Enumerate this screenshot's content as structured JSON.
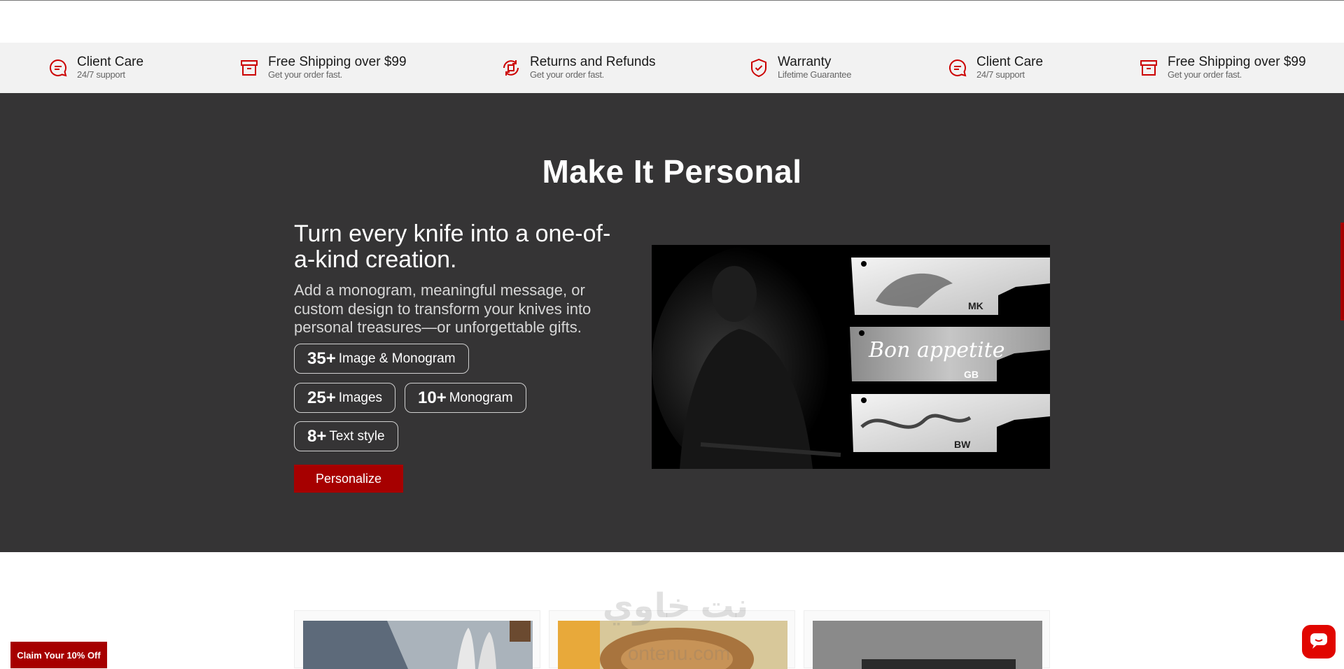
{
  "features": [
    {
      "icon": "chat-bubble-icon",
      "title": "Client Care",
      "sub": "24/7 support"
    },
    {
      "icon": "shipping-box-icon",
      "title": "Free Shipping over $99",
      "sub": "Get your order fast."
    },
    {
      "icon": "returns-icon",
      "title": "Returns and Refunds",
      "sub": "Get your order fast."
    },
    {
      "icon": "shield-check-icon",
      "title": "Warranty",
      "sub": "Lifetime Guarantee"
    },
    {
      "icon": "chat-bubble-icon",
      "title": "Client Care",
      "sub": "24/7 support"
    },
    {
      "icon": "shipping-box-icon",
      "title": "Free Shipping over $99",
      "sub": "Get your order fast."
    }
  ],
  "personal": {
    "heading": "Make It Personal",
    "tagline": "Turn every knife into a one-of-a-kind creation.",
    "description": "Add a monogram, meaningful message, or custom design to transform your knives into personal treasures—or unforgettable gifts.",
    "pills": [
      {
        "num": "35+",
        "label": "Image & Monogram"
      },
      {
        "num": "25+",
        "label": "Images"
      },
      {
        "num": "10+",
        "label": "Monogram"
      },
      {
        "num": "8+",
        "label": "Text style"
      }
    ],
    "cta": "Personalize",
    "engravings": [
      "MK",
      "GB",
      "BW"
    ],
    "script_text": "Bon appetite"
  },
  "claim_label": "Claim Your 10% Off",
  "watermark": {
    "line1": "نت خاوي",
    "line2": "ontenu.com"
  },
  "colors": {
    "accent": "#a60000",
    "dark_bg": "#353435",
    "chat": "#e10600"
  }
}
